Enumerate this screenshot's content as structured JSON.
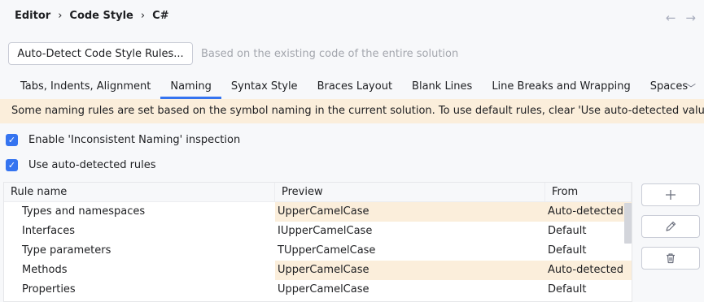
{
  "breadcrumb": {
    "items": [
      "Editor",
      "Code Style",
      "C#"
    ],
    "separator": "›"
  },
  "nav": {
    "back_icon": "←",
    "forward_icon": "→"
  },
  "autodetect": {
    "button_label": "Auto-Detect Code Style Rules...",
    "hint": "Based on the existing code of the entire solution"
  },
  "tabs": [
    {
      "label": "Tabs, Indents, Alignment",
      "active": false
    },
    {
      "label": "Naming",
      "active": true
    },
    {
      "label": "Syntax Style",
      "active": false
    },
    {
      "label": "Braces Layout",
      "active": false
    },
    {
      "label": "Blank Lines",
      "active": false
    },
    {
      "label": "Line Breaks and Wrapping",
      "active": false
    },
    {
      "label": "Spaces",
      "active": false
    }
  ],
  "tabs_more_icon": "﹀",
  "banner": {
    "text": "Some naming rules are set based on the symbol naming in the current solution. To use default rules, clear 'Use auto-detected values'."
  },
  "checkboxes": {
    "inconsistent_naming": {
      "label": "Enable 'Inconsistent Naming' inspection",
      "checked": true
    },
    "auto_detected_rules": {
      "label": "Use auto-detected rules",
      "checked": true
    }
  },
  "table": {
    "headers": {
      "rule": "Rule name",
      "preview": "Preview",
      "from": "From"
    },
    "rows": [
      {
        "rule": "Types and namespaces",
        "preview": "UpperCamelCase",
        "from": "Auto-detected",
        "highlight": true
      },
      {
        "rule": "Interfaces",
        "preview": "IUpperCamelCase",
        "from": "Default",
        "highlight": false
      },
      {
        "rule": "Type parameters",
        "preview": "TUpperCamelCase",
        "from": "Default",
        "highlight": false
      },
      {
        "rule": "Methods",
        "preview": "UpperCamelCase",
        "from": "Auto-detected",
        "highlight": true
      },
      {
        "rule": "Properties",
        "preview": "UpperCamelCase",
        "from": "Default",
        "highlight": false
      }
    ]
  },
  "side_buttons": {
    "add_icon": "plus-icon",
    "edit_icon": "pencil-icon",
    "delete_icon": "trash-icon"
  },
  "colors": {
    "accent": "#3574f0",
    "highlight": "#fbeedb",
    "background": "#f7f8fa"
  }
}
